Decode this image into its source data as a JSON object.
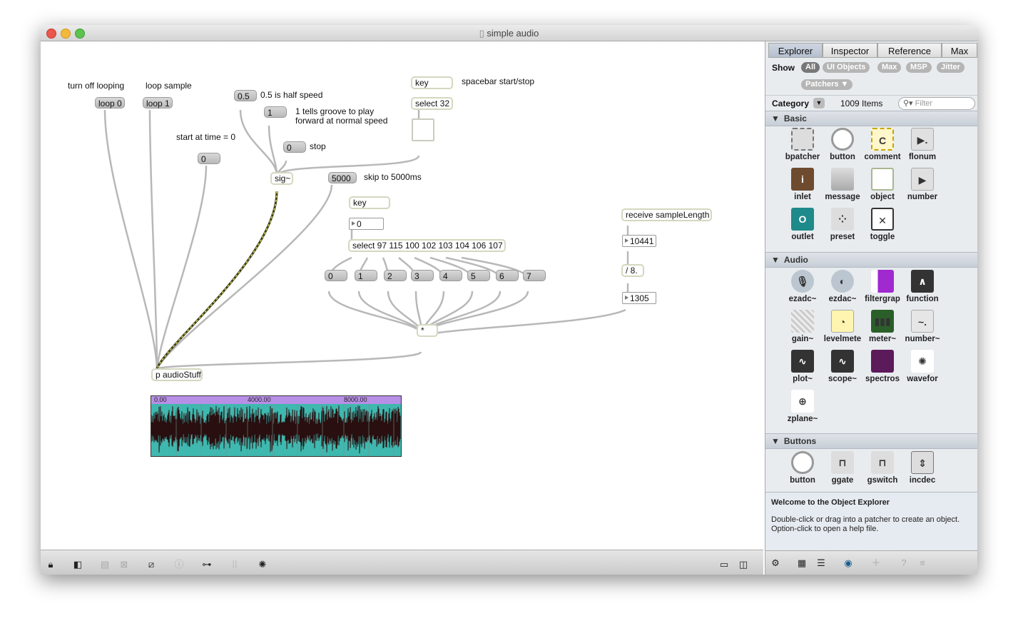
{
  "window": {
    "title": "simple audio"
  },
  "patch": {
    "comments": {
      "turn_off": "turn off looping",
      "loop_sample": "loop sample",
      "start_time": "start at time = 0",
      "half_speed": "0.5 is half speed",
      "groove_line1": "1 tells groove to play",
      "groove_line2": "forward at normal speed",
      "stop": "stop",
      "skip": "skip to 5000ms",
      "spacebar": "spacebar start/stop"
    },
    "messages": {
      "loop0": "loop 0",
      "loop1": "loop 1",
      "zero_start": "0",
      "half": "0.5",
      "one": "1",
      "stop_zero": "0",
      "skip5000": "5000",
      "m0": "0",
      "m1": "1",
      "m2": "2",
      "m3": "3",
      "m4": "4",
      "m5": "5",
      "m6": "6",
      "m7": "7"
    },
    "objects": {
      "key1": "key",
      "select32": "select 32",
      "sig": "sig~",
      "key2": "key",
      "select_keys": "select 97 115 100 102 103 104 106 107",
      "receive": "receive sampleLength",
      "div8": "/ 8.",
      "mult": "*",
      "audiostuff": "p audioStuff"
    },
    "numbers": {
      "key_num": "0",
      "sample_length": "10441",
      "divided": "1305"
    },
    "waveform": {
      "labels": [
        "0.00",
        "4000.00",
        "8000.00"
      ]
    }
  },
  "sidebar": {
    "tabs": [
      "Explorer",
      "Inspector",
      "Reference",
      "Max"
    ],
    "show_label": "Show",
    "filters": [
      "All",
      "UI Objects",
      "Max",
      "MSP",
      "Jitter"
    ],
    "patchers": "Patchers ▼",
    "category_label": "Category",
    "item_count": "1009 Items",
    "filter_placeholder": "Filter",
    "sections": {
      "basic": "Basic",
      "audio": "Audio",
      "buttons": "Buttons"
    },
    "basic_items": [
      "bpatcher",
      "button",
      "comment",
      "flonum",
      "inlet",
      "message",
      "object",
      "number",
      "outlet",
      "preset",
      "toggle"
    ],
    "audio_items": [
      "ezadc~",
      "ezdac~",
      "filtergrap",
      "function",
      "gain~",
      "levelmete",
      "meter~",
      "number~",
      "plot~",
      "scope~",
      "spectros",
      "wavefor",
      "zplane~"
    ],
    "button_items": [
      "button",
      "ggate",
      "gswitch",
      "incdec"
    ],
    "info_title": "Welcome to the Object Explorer",
    "info_text": "Double-click or drag into a patcher to create an object.\nOption-click to open a help file."
  },
  "colors": {
    "accent": "#b88fe6",
    "wave_bg": "#3fb8b0",
    "wave": "#2a0f10"
  }
}
